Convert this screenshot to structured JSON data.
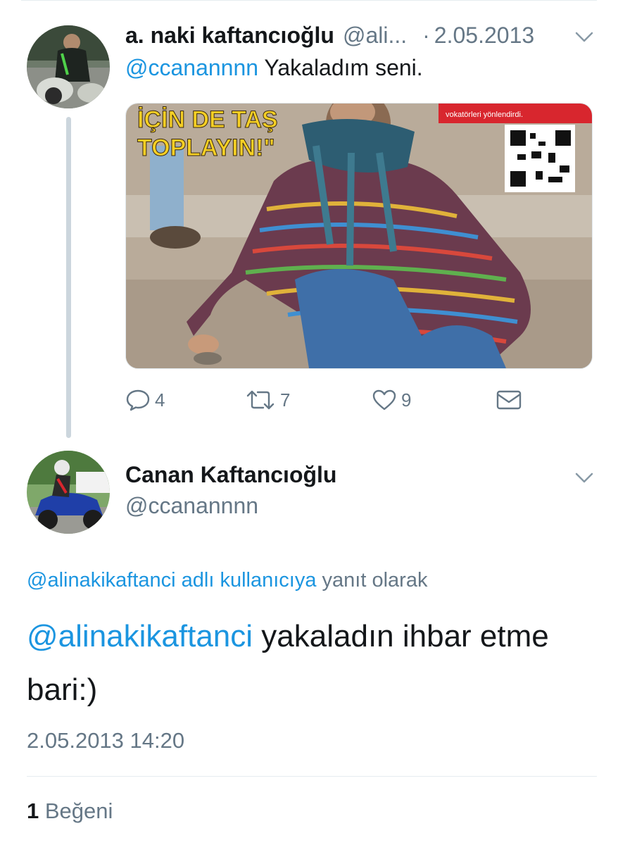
{
  "parent_tweet": {
    "author_name": "a. naki kaftancıoğlu",
    "author_handle": "@ali...",
    "date": "2.05.2013",
    "mention": "@ccanannnn",
    "text": "Yakaladım seni.",
    "media": {
      "headline_line1": "İÇİN DE TAŞ",
      "headline_line2": "TOPLAYIN!\"",
      "caption_strip": "vokatörleri yönlendirdi."
    },
    "reply_count": "4",
    "retweet_count": "7",
    "like_count": "9"
  },
  "main_tweet": {
    "author_name": "Canan Kaftancıoğlu",
    "author_handle": "@ccanannnn",
    "reply_to_link": "@alinakikaftanci adlı kullanıcıya",
    "reply_to_suffix": "yanıt olarak",
    "mention": "@alinakikaftanci",
    "text": "yakaladın ihbar etme bari:)",
    "timestamp": "2.05.2013 14:20",
    "like_count": "1",
    "like_label": "Beğeni"
  },
  "colors": {
    "link": "#1b95e0",
    "secondary_text": "#657786",
    "thread_line": "#ccd6dd"
  },
  "icons": {
    "reply": "speech-bubble-icon",
    "retweet": "retweet-arrows-icon",
    "like": "heart-icon",
    "dm": "envelope-icon",
    "more": "chevron-down-icon"
  }
}
